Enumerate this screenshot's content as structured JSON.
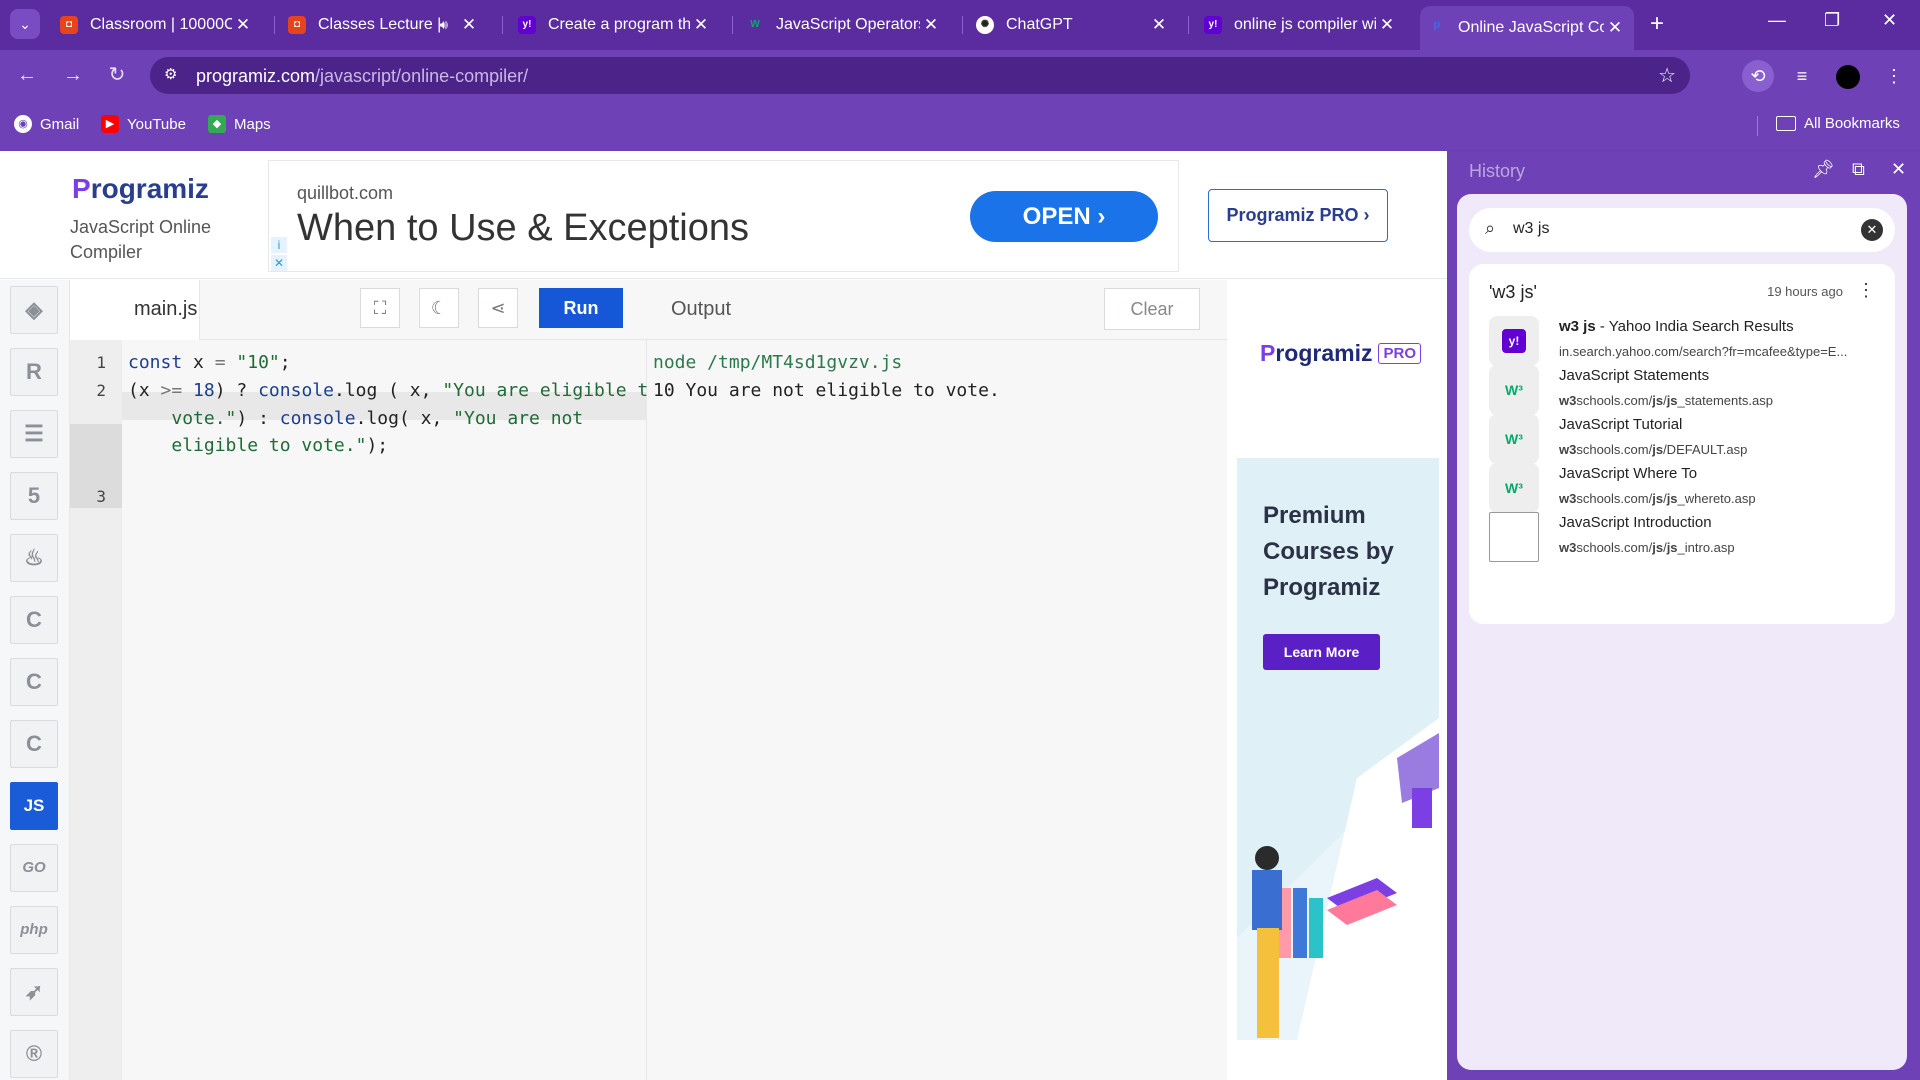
{
  "tabs": [
    {
      "title": "Classroom | 10000Co",
      "icon": "classroom-icon"
    },
    {
      "title": "Classes Lecture |",
      "icon": "classes-icon",
      "audio": true
    },
    {
      "title": "Create a program tha",
      "icon": "yahoo-icon"
    },
    {
      "title": "JavaScript Operators",
      "icon": "w3schools-icon"
    },
    {
      "title": "ChatGPT",
      "icon": "chatgpt-icon"
    },
    {
      "title": "online js compiler wi",
      "icon": "yahoo-icon"
    },
    {
      "title": "Online JavaScript Co",
      "icon": "programiz-icon",
      "active": true
    }
  ],
  "address": {
    "host": "programiz.com",
    "path": "/javascript/online-compiler/"
  },
  "bookmarks": [
    {
      "label": "Gmail",
      "icon": "gmail-icon"
    },
    {
      "label": "YouTube",
      "icon": "youtube-icon"
    },
    {
      "label": "Maps",
      "icon": "maps-icon"
    }
  ],
  "all_bookmarks": "All Bookmarks",
  "programiz": {
    "logo": "rogramiz",
    "logo_initial": "P",
    "subtitle": "JavaScript Online Compiler",
    "pro_button": "Programiz PRO ›"
  },
  "ad": {
    "domain": "quillbot.com",
    "headline": "When to Use & Exceptions",
    "button": "OPEN  ›",
    "info": "i",
    "close": "✕"
  },
  "rail": [
    "python-icon",
    "r-icon",
    "sql-icon",
    "html-icon",
    "java-icon",
    "c-icon",
    "cpp-icon",
    "csharp-icon",
    "JS",
    "GO",
    "php",
    "swift-icon",
    "rust-icon"
  ],
  "editor": {
    "filename": "main.js",
    "run_label": "Run",
    "line_numbers": [
      "1",
      "2",
      "3"
    ]
  },
  "output": {
    "title": "Output",
    "clear_label": "Clear",
    "lines": [
      "node /tmp/MT4sd1gvzv.js",
      "10 You are not eligible to vote."
    ]
  },
  "side_ad": {
    "logo": "rogramiz",
    "logo_initial": "P",
    "pro_badge": "PRO",
    "text": "Premium Courses by Programiz",
    "button": "Learn More"
  },
  "history": {
    "title": "History",
    "query": "w3 js",
    "card_title": "'w3 js'",
    "time": "19 hours ago",
    "items": [
      {
        "title": "w3 js - Yahoo India Search Results",
        "title_bold": "w3 js",
        "title_rest": " - Yahoo India Search Results",
        "url": "in.search.yahoo.com/search?fr=mcafee&type=E...",
        "icon": "yahoo"
      },
      {
        "title": "JavaScript Statements",
        "url_bold": "w3",
        "url_rest": "schools.com/",
        "url_bold2": "js",
        "url_rest2": "/",
        "url_bold3": "js",
        "url_rest3": "_statements.asp",
        "icon": "w3"
      },
      {
        "title": "JavaScript Tutorial",
        "url_bold": "w3",
        "url_rest": "schools.com/",
        "url_bold2": "js",
        "url_rest2": "/DEFAULT.asp",
        "url_bold3": "",
        "url_rest3": "",
        "icon": "w3"
      },
      {
        "title": "JavaScript Where To",
        "url_bold": "w3",
        "url_rest": "schools.com/",
        "url_bold2": "js",
        "url_rest2": "/",
        "url_bold3": "js",
        "url_rest3": "_whereto.asp",
        "icon": "w3"
      },
      {
        "title": "JavaScript Introduction",
        "url_bold": "w3",
        "url_rest": "schools.com/",
        "url_bold2": "js",
        "url_rest2": "/",
        "url_bold3": "js",
        "url_rest3": "_intro.asp",
        "icon": "img"
      }
    ]
  },
  "colors": {
    "accent": "#6e41b6",
    "run": "#1557d6",
    "js_active": "#1a5bd8"
  }
}
